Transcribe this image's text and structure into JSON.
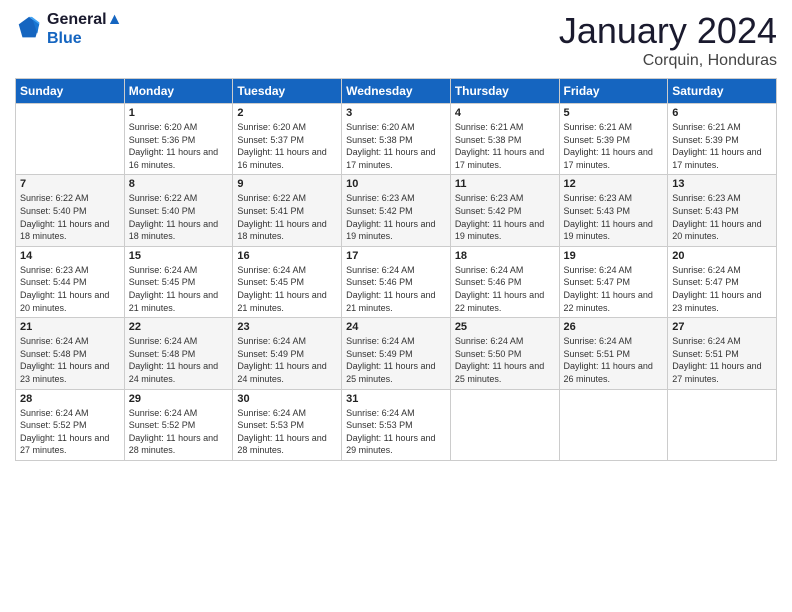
{
  "logo": {
    "line1": "General",
    "line2": "Blue"
  },
  "title": "January 2024",
  "subtitle": "Corquin, Honduras",
  "days_header": [
    "Sunday",
    "Monday",
    "Tuesday",
    "Wednesday",
    "Thursday",
    "Friday",
    "Saturday"
  ],
  "weeks": [
    [
      {
        "num": "",
        "sunrise": "",
        "sunset": "",
        "daylight": ""
      },
      {
        "num": "1",
        "sunrise": "Sunrise: 6:20 AM",
        "sunset": "Sunset: 5:36 PM",
        "daylight": "Daylight: 11 hours and 16 minutes."
      },
      {
        "num": "2",
        "sunrise": "Sunrise: 6:20 AM",
        "sunset": "Sunset: 5:37 PM",
        "daylight": "Daylight: 11 hours and 16 minutes."
      },
      {
        "num": "3",
        "sunrise": "Sunrise: 6:20 AM",
        "sunset": "Sunset: 5:38 PM",
        "daylight": "Daylight: 11 hours and 17 minutes."
      },
      {
        "num": "4",
        "sunrise": "Sunrise: 6:21 AM",
        "sunset": "Sunset: 5:38 PM",
        "daylight": "Daylight: 11 hours and 17 minutes."
      },
      {
        "num": "5",
        "sunrise": "Sunrise: 6:21 AM",
        "sunset": "Sunset: 5:39 PM",
        "daylight": "Daylight: 11 hours and 17 minutes."
      },
      {
        "num": "6",
        "sunrise": "Sunrise: 6:21 AM",
        "sunset": "Sunset: 5:39 PM",
        "daylight": "Daylight: 11 hours and 17 minutes."
      }
    ],
    [
      {
        "num": "7",
        "sunrise": "Sunrise: 6:22 AM",
        "sunset": "Sunset: 5:40 PM",
        "daylight": "Daylight: 11 hours and 18 minutes."
      },
      {
        "num": "8",
        "sunrise": "Sunrise: 6:22 AM",
        "sunset": "Sunset: 5:40 PM",
        "daylight": "Daylight: 11 hours and 18 minutes."
      },
      {
        "num": "9",
        "sunrise": "Sunrise: 6:22 AM",
        "sunset": "Sunset: 5:41 PM",
        "daylight": "Daylight: 11 hours and 18 minutes."
      },
      {
        "num": "10",
        "sunrise": "Sunrise: 6:23 AM",
        "sunset": "Sunset: 5:42 PM",
        "daylight": "Daylight: 11 hours and 19 minutes."
      },
      {
        "num": "11",
        "sunrise": "Sunrise: 6:23 AM",
        "sunset": "Sunset: 5:42 PM",
        "daylight": "Daylight: 11 hours and 19 minutes."
      },
      {
        "num": "12",
        "sunrise": "Sunrise: 6:23 AM",
        "sunset": "Sunset: 5:43 PM",
        "daylight": "Daylight: 11 hours and 19 minutes."
      },
      {
        "num": "13",
        "sunrise": "Sunrise: 6:23 AM",
        "sunset": "Sunset: 5:43 PM",
        "daylight": "Daylight: 11 hours and 20 minutes."
      }
    ],
    [
      {
        "num": "14",
        "sunrise": "Sunrise: 6:23 AM",
        "sunset": "Sunset: 5:44 PM",
        "daylight": "Daylight: 11 hours and 20 minutes."
      },
      {
        "num": "15",
        "sunrise": "Sunrise: 6:24 AM",
        "sunset": "Sunset: 5:45 PM",
        "daylight": "Daylight: 11 hours and 21 minutes."
      },
      {
        "num": "16",
        "sunrise": "Sunrise: 6:24 AM",
        "sunset": "Sunset: 5:45 PM",
        "daylight": "Daylight: 11 hours and 21 minutes."
      },
      {
        "num": "17",
        "sunrise": "Sunrise: 6:24 AM",
        "sunset": "Sunset: 5:46 PM",
        "daylight": "Daylight: 11 hours and 21 minutes."
      },
      {
        "num": "18",
        "sunrise": "Sunrise: 6:24 AM",
        "sunset": "Sunset: 5:46 PM",
        "daylight": "Daylight: 11 hours and 22 minutes."
      },
      {
        "num": "19",
        "sunrise": "Sunrise: 6:24 AM",
        "sunset": "Sunset: 5:47 PM",
        "daylight": "Daylight: 11 hours and 22 minutes."
      },
      {
        "num": "20",
        "sunrise": "Sunrise: 6:24 AM",
        "sunset": "Sunset: 5:47 PM",
        "daylight": "Daylight: 11 hours and 23 minutes."
      }
    ],
    [
      {
        "num": "21",
        "sunrise": "Sunrise: 6:24 AM",
        "sunset": "Sunset: 5:48 PM",
        "daylight": "Daylight: 11 hours and 23 minutes."
      },
      {
        "num": "22",
        "sunrise": "Sunrise: 6:24 AM",
        "sunset": "Sunset: 5:48 PM",
        "daylight": "Daylight: 11 hours and 24 minutes."
      },
      {
        "num": "23",
        "sunrise": "Sunrise: 6:24 AM",
        "sunset": "Sunset: 5:49 PM",
        "daylight": "Daylight: 11 hours and 24 minutes."
      },
      {
        "num": "24",
        "sunrise": "Sunrise: 6:24 AM",
        "sunset": "Sunset: 5:49 PM",
        "daylight": "Daylight: 11 hours and 25 minutes."
      },
      {
        "num": "25",
        "sunrise": "Sunrise: 6:24 AM",
        "sunset": "Sunset: 5:50 PM",
        "daylight": "Daylight: 11 hours and 25 minutes."
      },
      {
        "num": "26",
        "sunrise": "Sunrise: 6:24 AM",
        "sunset": "Sunset: 5:51 PM",
        "daylight": "Daylight: 11 hours and 26 minutes."
      },
      {
        "num": "27",
        "sunrise": "Sunrise: 6:24 AM",
        "sunset": "Sunset: 5:51 PM",
        "daylight": "Daylight: 11 hours and 27 minutes."
      }
    ],
    [
      {
        "num": "28",
        "sunrise": "Sunrise: 6:24 AM",
        "sunset": "Sunset: 5:52 PM",
        "daylight": "Daylight: 11 hours and 27 minutes."
      },
      {
        "num": "29",
        "sunrise": "Sunrise: 6:24 AM",
        "sunset": "Sunset: 5:52 PM",
        "daylight": "Daylight: 11 hours and 28 minutes."
      },
      {
        "num": "30",
        "sunrise": "Sunrise: 6:24 AM",
        "sunset": "Sunset: 5:53 PM",
        "daylight": "Daylight: 11 hours and 28 minutes."
      },
      {
        "num": "31",
        "sunrise": "Sunrise: 6:24 AM",
        "sunset": "Sunset: 5:53 PM",
        "daylight": "Daylight: 11 hours and 29 minutes."
      },
      {
        "num": "",
        "sunrise": "",
        "sunset": "",
        "daylight": ""
      },
      {
        "num": "",
        "sunrise": "",
        "sunset": "",
        "daylight": ""
      },
      {
        "num": "",
        "sunrise": "",
        "sunset": "",
        "daylight": ""
      }
    ]
  ]
}
